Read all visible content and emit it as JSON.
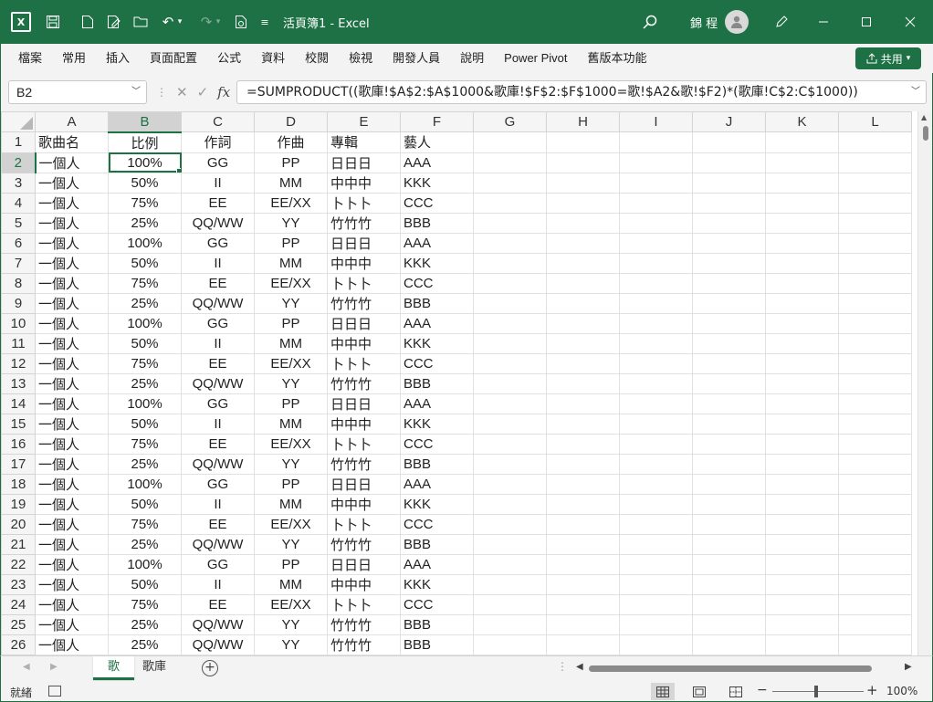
{
  "window": {
    "title": "活頁簿1  -  Excel",
    "user": "錦 程"
  },
  "ribbon": {
    "tabs": [
      "檔案",
      "常用",
      "插入",
      "頁面配置",
      "公式",
      "資料",
      "校閱",
      "檢視",
      "開發人員",
      "說明",
      "Power Pivot",
      "舊版本功能"
    ],
    "share_label": "共用"
  },
  "formula_bar": {
    "name_box": "B2",
    "formula": "=SUMPRODUCT((歌庫!$A$2:$A$1000&歌庫!$F$2:$F$1000=歌!$A2&歌!$F2)*(歌庫!C$2:C$1000))"
  },
  "grid": {
    "columns": [
      "A",
      "B",
      "C",
      "D",
      "E",
      "F",
      "G",
      "H",
      "I",
      "J",
      "K",
      "L"
    ],
    "selected_column": "B",
    "selected_row": 2,
    "rows": [
      {
        "n": "1",
        "cells": [
          "歌曲名",
          "比例",
          "作詞",
          "作曲",
          "專輯",
          "藝人"
        ]
      },
      {
        "n": "2",
        "cells": [
          "一個人",
          "100%",
          "GG",
          "PP",
          "日日日",
          "AAA"
        ]
      },
      {
        "n": "3",
        "cells": [
          "一個人",
          "50%",
          "II",
          "MM",
          "中中中",
          "KKK"
        ]
      },
      {
        "n": "4",
        "cells": [
          "一個人",
          "75%",
          "EE",
          "EE/XX",
          "卜卜卜",
          "CCC"
        ]
      },
      {
        "n": "5",
        "cells": [
          "一個人",
          "25%",
          "QQ/WW",
          "YY",
          "竹竹竹",
          "BBB"
        ]
      },
      {
        "n": "6",
        "cells": [
          "一個人",
          "100%",
          "GG",
          "PP",
          "日日日",
          "AAA"
        ]
      },
      {
        "n": "7",
        "cells": [
          "一個人",
          "50%",
          "II",
          "MM",
          "中中中",
          "KKK"
        ]
      },
      {
        "n": "8",
        "cells": [
          "一個人",
          "75%",
          "EE",
          "EE/XX",
          "卜卜卜",
          "CCC"
        ]
      },
      {
        "n": "9",
        "cells": [
          "一個人",
          "25%",
          "QQ/WW",
          "YY",
          "竹竹竹",
          "BBB"
        ]
      },
      {
        "n": "10",
        "cells": [
          "一個人",
          "100%",
          "GG",
          "PP",
          "日日日",
          "AAA"
        ]
      },
      {
        "n": "11",
        "cells": [
          "一個人",
          "50%",
          "II",
          "MM",
          "中中中",
          "KKK"
        ]
      },
      {
        "n": "12",
        "cells": [
          "一個人",
          "75%",
          "EE",
          "EE/XX",
          "卜卜卜",
          "CCC"
        ]
      },
      {
        "n": "13",
        "cells": [
          "一個人",
          "25%",
          "QQ/WW",
          "YY",
          "竹竹竹",
          "BBB"
        ]
      },
      {
        "n": "14",
        "cells": [
          "一個人",
          "100%",
          "GG",
          "PP",
          "日日日",
          "AAA"
        ]
      },
      {
        "n": "15",
        "cells": [
          "一個人",
          "50%",
          "II",
          "MM",
          "中中中",
          "KKK"
        ]
      },
      {
        "n": "16",
        "cells": [
          "一個人",
          "75%",
          "EE",
          "EE/XX",
          "卜卜卜",
          "CCC"
        ]
      },
      {
        "n": "17",
        "cells": [
          "一個人",
          "25%",
          "QQ/WW",
          "YY",
          "竹竹竹",
          "BBB"
        ]
      },
      {
        "n": "18",
        "cells": [
          "一個人",
          "100%",
          "GG",
          "PP",
          "日日日",
          "AAA"
        ]
      },
      {
        "n": "19",
        "cells": [
          "一個人",
          "50%",
          "II",
          "MM",
          "中中中",
          "KKK"
        ]
      },
      {
        "n": "20",
        "cells": [
          "一個人",
          "75%",
          "EE",
          "EE/XX",
          "卜卜卜",
          "CCC"
        ]
      },
      {
        "n": "21",
        "cells": [
          "一個人",
          "25%",
          "QQ/WW",
          "YY",
          "竹竹竹",
          "BBB"
        ]
      },
      {
        "n": "22",
        "cells": [
          "一個人",
          "100%",
          "GG",
          "PP",
          "日日日",
          "AAA"
        ]
      },
      {
        "n": "23",
        "cells": [
          "一個人",
          "50%",
          "II",
          "MM",
          "中中中",
          "KKK"
        ]
      },
      {
        "n": "24",
        "cells": [
          "一個人",
          "75%",
          "EE",
          "EE/XX",
          "卜卜卜",
          "CCC"
        ]
      },
      {
        "n": "25",
        "cells": [
          "一個人",
          "25%",
          "QQ/WW",
          "YY",
          "竹竹竹",
          "BBB"
        ]
      },
      {
        "n": "26",
        "cells": [
          "一個人",
          "25%",
          "QQ/WW",
          "YY",
          "竹竹竹",
          "BBB"
        ]
      }
    ]
  },
  "sheets": {
    "tabs": [
      "歌",
      "歌庫"
    ],
    "active": "歌"
  },
  "status_bar": {
    "status": "就緒",
    "zoom": "100%"
  },
  "colors": {
    "accent": "#1e7145",
    "ribbon_bg": "#f3f3f3"
  }
}
